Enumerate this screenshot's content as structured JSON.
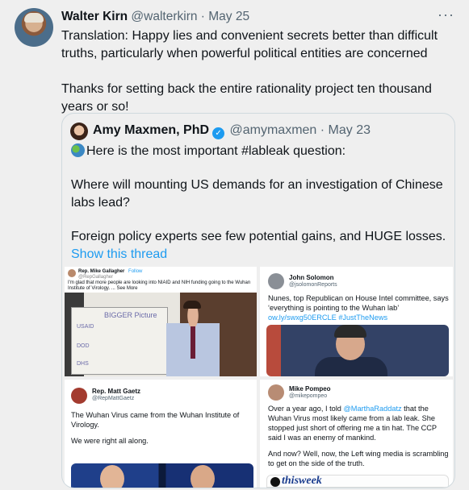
{
  "tweet": {
    "author_name": "Walter Kirn",
    "author_handle": "@walterkirn",
    "date": "· May 25",
    "more": "···",
    "text_p1": "Translation: Happy lies and convenient secrets better than difficult truths, particularly when powerful political entities are concerned",
    "text_p2": "Thanks for setting back the entire rationality project ten thousand years or so!"
  },
  "quote": {
    "author_name": "Amy Maxmen, PhD",
    "verified_glyph": "✓",
    "author_handle": "@amymaxmen",
    "date": "· May 23",
    "line1": "Here is the most important #lableak question:",
    "para1": "Where will mounting US demands for an investigation of Chinese labs lead?",
    "para2": "Foreign policy experts see few potential gains, and HUGE losses.",
    "show_thread": "Show this thread"
  },
  "grid": {
    "c1": {
      "name": "Rep. Mike Gallagher",
      "follow": "Follow",
      "handle": "@RepGallagher",
      "text": "I'm glad that more people are looking into NIAID and NIH funding going to the Wuhan Institute of Virology.",
      "see_more": "... See More",
      "board": [
        "BIGGER Picture",
        "USAID",
        "DOD",
        "DHS"
      ]
    },
    "c2": {
      "name": "John Solomon",
      "handle": "@jsolomonReports",
      "text": "Nunes, top Republican on House Intel committee, says ‘everything is pointing to the Wuhan lab’",
      "link": "ow.ly/swxg50ERCLE #JustTheNews"
    },
    "c3": {
      "name": "Rep. Matt Gaetz",
      "handle": "@RepMattGaetz",
      "text1": "The Wuhan Virus came from the Wuhan Institute of Virology.",
      "text2": "We were right all along."
    },
    "c4": {
      "name": "Mike Pompeo",
      "handle": "@mikepompeo",
      "text1_a": "Over a year ago, I told ",
      "text1_link": "@MarthaRaddatz",
      "text1_b": " that the Wuhan Virus most likely came from a lab leak. She stopped just short of offering me a tin hat. The CCP said I was an enemy of mankind.",
      "text2": "And now? Well, now, the Left wing media is scrambling to get on the side of the truth.",
      "logo": "thisweek"
    }
  },
  "colors": {
    "background": "#efefef",
    "text": "#0f1419",
    "secondary": "#536471",
    "link": "#1d9bf0",
    "border": "#cfd9de"
  }
}
